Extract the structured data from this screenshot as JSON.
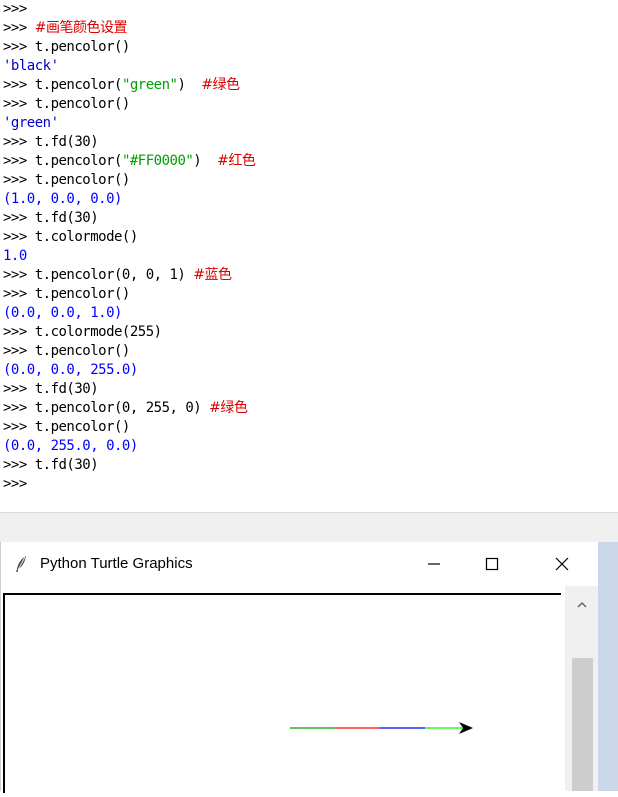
{
  "shell": {
    "lines": [
      {
        "prompt": ">>>",
        "code": "",
        "str": "",
        "code2": "",
        "comment": "",
        "out": "",
        "out_class": ""
      },
      {
        "prompt": ">>> ",
        "code": "",
        "str": "",
        "code2": "",
        "comment": "#画笔颜色设置",
        "out": "",
        "out_class": ""
      },
      {
        "prompt": ">>> ",
        "code": "t.pencolor()",
        "str": "",
        "code2": "",
        "comment": "",
        "out": "",
        "out_class": ""
      },
      {
        "prompt": "",
        "code": "",
        "str": "",
        "code2": "",
        "comment": "",
        "out": "'black'",
        "out_class": "out-str"
      },
      {
        "prompt": ">>> ",
        "code": "t.pencolor(",
        "str": "\"green\"",
        "code2": ")  ",
        "comment": "#绿色",
        "out": "",
        "out_class": ""
      },
      {
        "prompt": ">>> ",
        "code": "t.pencolor()",
        "str": "",
        "code2": "",
        "comment": "",
        "out": "",
        "out_class": ""
      },
      {
        "prompt": "",
        "code": "",
        "str": "",
        "code2": "",
        "comment": "",
        "out": "'green'",
        "out_class": "out-str"
      },
      {
        "prompt": ">>> ",
        "code": "t.fd(30)",
        "str": "",
        "code2": "",
        "comment": "",
        "out": "",
        "out_class": ""
      },
      {
        "prompt": ">>> ",
        "code": "t.pencolor(",
        "str": "\"#FF0000\"",
        "code2": ")  ",
        "comment": "#红色",
        "out": "",
        "out_class": ""
      },
      {
        "prompt": ">>> ",
        "code": "t.pencolor()",
        "str": "",
        "code2": "",
        "comment": "",
        "out": "",
        "out_class": ""
      },
      {
        "prompt": "",
        "code": "",
        "str": "",
        "code2": "",
        "comment": "",
        "out": "(1.0, 0.0, 0.0)",
        "out_class": "out-val"
      },
      {
        "prompt": ">>> ",
        "code": "t.fd(30)",
        "str": "",
        "code2": "",
        "comment": "",
        "out": "",
        "out_class": ""
      },
      {
        "prompt": ">>> ",
        "code": "t.colormode()",
        "str": "",
        "code2": "",
        "comment": "",
        "out": "",
        "out_class": ""
      },
      {
        "prompt": "",
        "code": "",
        "str": "",
        "code2": "",
        "comment": "",
        "out": "1.0",
        "out_class": "out-val"
      },
      {
        "prompt": ">>> ",
        "code": "t.pencolor(0, 0, 1) ",
        "str": "",
        "code2": "",
        "comment": "#蓝色",
        "out": "",
        "out_class": ""
      },
      {
        "prompt": ">>> ",
        "code": "t.pencolor()",
        "str": "",
        "code2": "",
        "comment": "",
        "out": "",
        "out_class": ""
      },
      {
        "prompt": "",
        "code": "",
        "str": "",
        "code2": "",
        "comment": "",
        "out": "(0.0, 0.0, 1.0)",
        "out_class": "out-val"
      },
      {
        "prompt": ">>> ",
        "code": "t.colormode(255)",
        "str": "",
        "code2": "",
        "comment": "",
        "out": "",
        "out_class": ""
      },
      {
        "prompt": ">>> ",
        "code": "t.pencolor()",
        "str": "",
        "code2": "",
        "comment": "",
        "out": "",
        "out_class": ""
      },
      {
        "prompt": "",
        "code": "",
        "str": "",
        "code2": "",
        "comment": "",
        "out": "(0.0, 0.0, 255.0)",
        "out_class": "out-val"
      },
      {
        "prompt": ">>> ",
        "code": "t.fd(30)",
        "str": "",
        "code2": "",
        "comment": "",
        "out": "",
        "out_class": ""
      },
      {
        "prompt": ">>> ",
        "code": "t.pencolor(0, 255, 0) ",
        "str": "",
        "code2": "",
        "comment": "#绿色",
        "out": "",
        "out_class": ""
      },
      {
        "prompt": ">>> ",
        "code": "t.pencolor()",
        "str": "",
        "code2": "",
        "comment": "",
        "out": "",
        "out_class": ""
      },
      {
        "prompt": "",
        "code": "",
        "str": "",
        "code2": "",
        "comment": "",
        "out": "(0.0, 255.0, 0.0)",
        "out_class": "out-val"
      },
      {
        "prompt": ">>> ",
        "code": "t.fd(30)",
        "str": "",
        "code2": "",
        "comment": "",
        "out": "",
        "out_class": ""
      },
      {
        "prompt": ">>>",
        "code": "",
        "str": "",
        "code2": "",
        "comment": "",
        "out": "",
        "out_class": ""
      }
    ]
  },
  "turtle_window": {
    "title": "Python Turtle Graphics",
    "icon": "feather-icon",
    "minimize_glyph": "—",
    "maximize_glyph": "☐",
    "close_glyph": "✕"
  },
  "drawing": {
    "segments": [
      {
        "color": "#00a000",
        "label": "green"
      },
      {
        "color": "#ff0000",
        "label": "red"
      },
      {
        "color": "#0000ff",
        "label": "blue"
      },
      {
        "color": "#00ff00",
        "label": "lime"
      }
    ],
    "arrow_color": "#000000"
  }
}
